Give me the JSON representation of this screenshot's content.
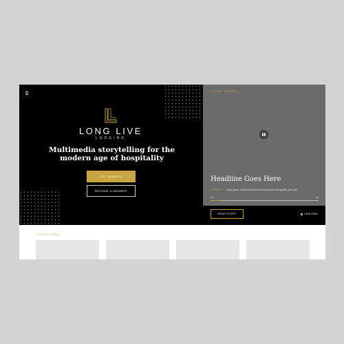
{
  "hero": {
    "brand_name": "LONG LIVE",
    "brand_sub": "LODGING",
    "tagline": "Multimedia storytelling for the modern age of hospitality",
    "primary_cta": "GET STARTED",
    "secondary_cta": "BECOME A MEMBER"
  },
  "video": {
    "section_label": "LODGING LEADERS",
    "headline": "Headline Goes Here",
    "author": "AUTHOR 01",
    "description": "Lorem ipsum is placeholder text commonly used in the graphic, print, and",
    "time_start": "0:00",
    "time_end": "0:00",
    "progress": 0.11,
    "read_cta": "READ STORY",
    "read_time": "4 MIN READ"
  },
  "latest_news": {
    "label": "LATEST NEWS",
    "cards": 4
  },
  "colors": {
    "accent": "#c9a440",
    "hero_bg": "#000000",
    "video_bg": "#6b6b6b",
    "page_bg": "#d3d3d3"
  },
  "icons": [
    "menu-icon",
    "logo-mark-icon",
    "pause-icon",
    "clock-icon"
  ]
}
